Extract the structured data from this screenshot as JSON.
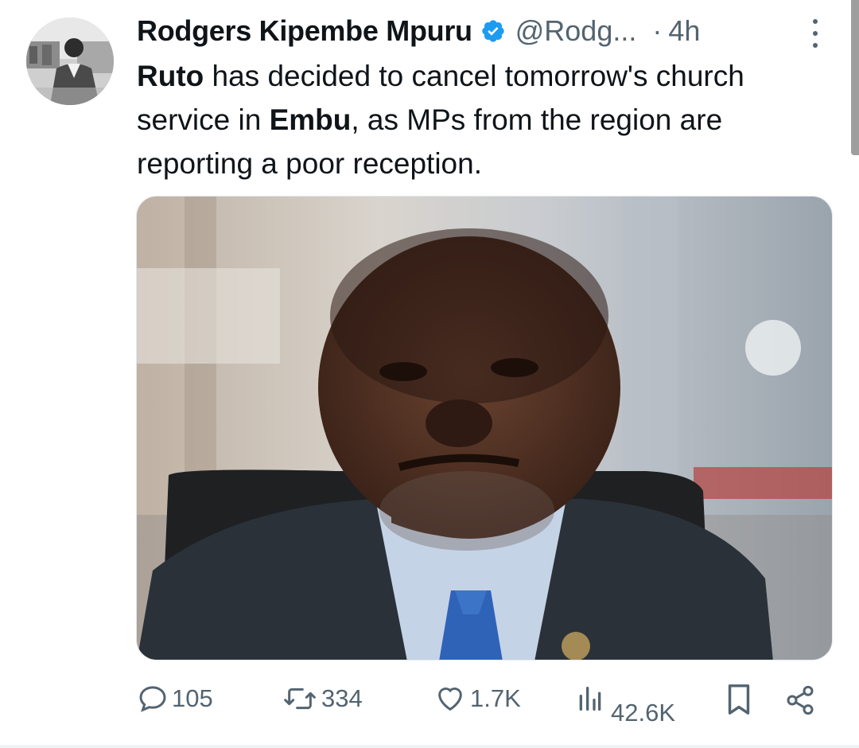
{
  "post": {
    "author_name": "Rodgers Kipembe Mpuru",
    "handle": "@Rodg...",
    "separator": "·",
    "time": "4h",
    "body": {
      "part1_bold": "Ruto",
      "part2": " has decided to cancel tomorrow's church service in ",
      "part3_bold": "Embu",
      "part4": ", as MPs from the region are reporting a poor reception."
    }
  },
  "actions": {
    "replies": "105",
    "reposts": "334",
    "likes": "1.7K",
    "views": "42.6K"
  },
  "icons": {
    "verified": "verified-badge-icon",
    "more": "more-vertical-icon",
    "reply": "reply-bubble-icon",
    "repost": "repost-icon",
    "like": "heart-icon",
    "views": "views-bar-chart-icon",
    "bookmark": "bookmark-icon",
    "share": "share-icon"
  },
  "colors": {
    "text": "#0f1419",
    "secondary": "#536471",
    "verified": "#1d9bf0"
  }
}
